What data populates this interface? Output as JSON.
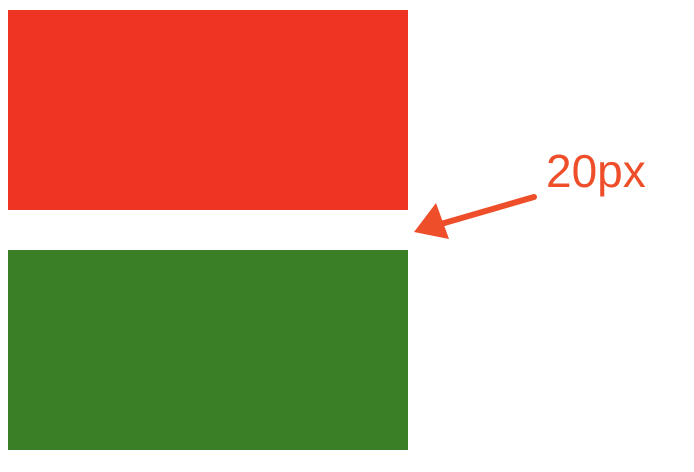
{
  "colors": {
    "top_box": "#EE3524",
    "bottom_box": "#3A7F25",
    "annotation": "#EE4E2A"
  },
  "annotation": {
    "label": "20px"
  }
}
